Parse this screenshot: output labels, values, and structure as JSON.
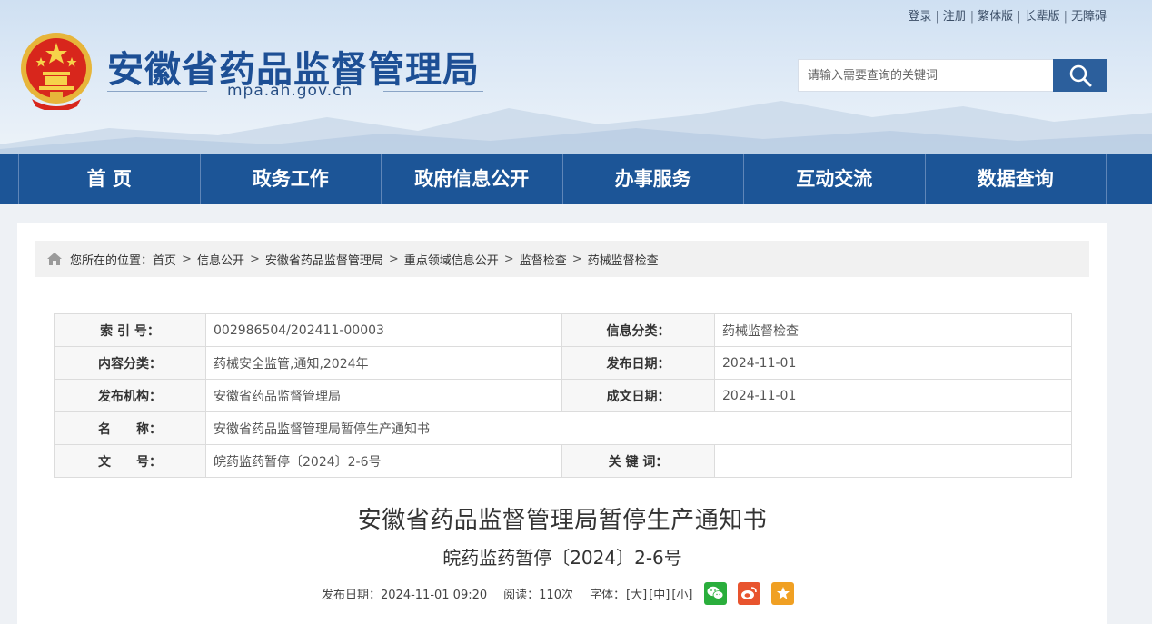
{
  "top_links": [
    "登录",
    "注册",
    "繁体版",
    "长辈版",
    "无障碍"
  ],
  "site": {
    "title": "安徽省药品监督管理局",
    "domain": "mpa.ah.gov.cn"
  },
  "search": {
    "placeholder": "请输入需要查询的关键词",
    "icon": "search-icon"
  },
  "nav": [
    "首 页",
    "政务工作",
    "政府信息公开",
    "办事服务",
    "互动交流",
    "数据查询"
  ],
  "breadcrumb": {
    "prefix": "您所在的位置：",
    "items": [
      "首页",
      "信息公开",
      "安徽省药品监督管理局",
      "重点领域信息公开",
      "监督检查",
      "药械监督检查"
    ],
    "separator": ">"
  },
  "meta": {
    "index_label": "索 引 号：",
    "index_value": "002986504/202411-00003",
    "category_label": "信息分类：",
    "category_value": "药械监督检查",
    "content_type_label": "内容分类：",
    "content_type_value": "药械安全监管,通知,2024年",
    "publish_date_label": "发布日期：",
    "publish_date_value": "2024-11-01",
    "org_label": "发布机构：",
    "org_value": "安徽省药品监督管理局",
    "created_date_label": "成文日期：",
    "created_date_value": "2024-11-01",
    "name_label": "名　　称：",
    "name_value": "安徽省药品监督管理局暂停生产通知书",
    "doc_no_label": "文　　号：",
    "doc_no_value": "皖药监药暂停〔2024〕2-6号",
    "keywords_label": "关 键 词：",
    "keywords_value": ""
  },
  "article": {
    "title": "安徽省药品监督管理局暂停生产通知书",
    "subtitle": "皖药监药暂停〔2024〕2-6号",
    "publish_info": "发布日期：2024-11-01 09:20",
    "reads": "阅读：110次",
    "font_label": "字体：",
    "font_sizes": [
      "[大]",
      "[中]",
      "[小]"
    ]
  },
  "share": [
    {
      "name": "wechat",
      "color": "#2aae3c"
    },
    {
      "name": "weibo",
      "color": "#e8542e"
    },
    {
      "name": "favorite",
      "color": "#f0a023"
    }
  ],
  "colors": {
    "brand_blue": "#1c5597",
    "title_blue": "#1d4f95"
  }
}
